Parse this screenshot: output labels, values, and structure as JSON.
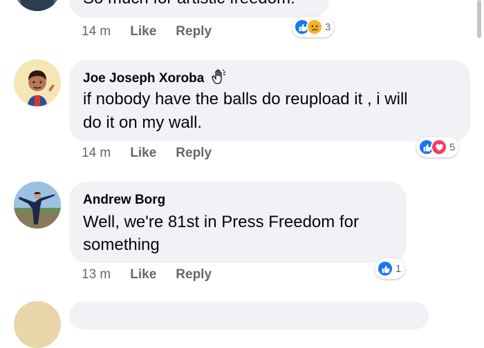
{
  "comments": [
    {
      "author": "",
      "text": "So much for artistic freedom.",
      "time": "14 m",
      "like": "Like",
      "reply": "Reply",
      "reactions": {
        "icons": [
          "like-icon",
          "sad-icon"
        ],
        "count": "3"
      }
    },
    {
      "author": "Joe Joseph Xoroba",
      "badge": "wave-icon",
      "text_line1": "if nobody have the balls do reupload it , i will",
      "text_line2": "do it on my wall.",
      "time": "14 m",
      "like": "Like",
      "reply": "Reply",
      "reactions": {
        "icons": [
          "like-icon",
          "love-icon"
        ],
        "count": "5"
      }
    },
    {
      "author": "Andrew Borg",
      "text_line1": "Well, we're 81st in Press Freedom for",
      "text_line2": "something",
      "time": "13 m",
      "like": "Like",
      "reply": "Reply",
      "reactions": {
        "icons": [
          "like-icon"
        ],
        "count": "1"
      }
    }
  ],
  "colors": {
    "like_blue": "#1877f2",
    "love_red": "#f33e58",
    "sad_yellow": "#f7b125",
    "bubble": "#f0f2f5",
    "meta_gray": "#65676b"
  }
}
